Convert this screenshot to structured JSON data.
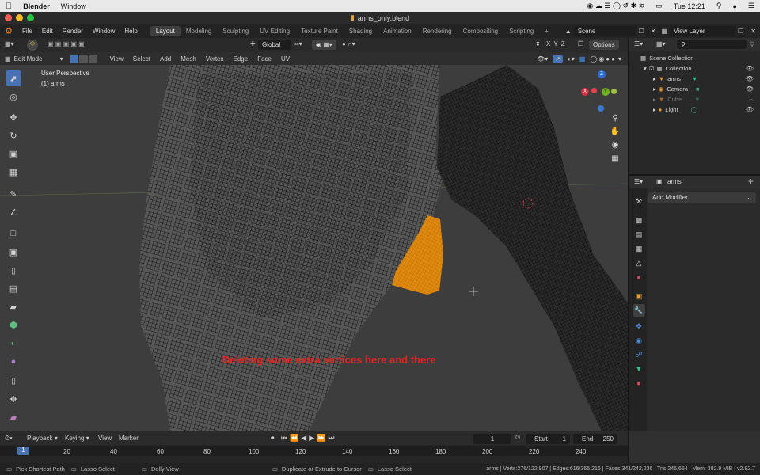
{
  "macbar": {
    "apple": "",
    "app": "Blender",
    "menu": "Window",
    "battery": "",
    "time": "Tue 12:21"
  },
  "window": {
    "title": "arms_only.blend"
  },
  "topmenu": {
    "items": [
      "File",
      "Edit",
      "Render",
      "Window",
      "Help"
    ]
  },
  "workspaces": {
    "tabs": [
      "Layout",
      "Modeling",
      "Sculpting",
      "UV Editing",
      "Texture Paint",
      "Shading",
      "Animation",
      "Rendering",
      "Compositing",
      "Scripting"
    ],
    "active": "Layout",
    "add": "+"
  },
  "scene": {
    "name": "Scene",
    "view_layer": "View Layer"
  },
  "viewport_header": {
    "mode": "Edit Mode",
    "menus": [
      "View",
      "Select",
      "Add",
      "Mesh",
      "Vertex",
      "Edge",
      "Face",
      "UV"
    ],
    "orientation": "Global",
    "options": "Options",
    "axes": [
      "X",
      "Y",
      "Z"
    ]
  },
  "viewport": {
    "perspective": "User Perspective",
    "object": "(1) arms",
    "annotation": "Deleting some extra vertices here and there"
  },
  "gizmo": {
    "x": "X",
    "y": "Y",
    "z": "Z"
  },
  "outliner": {
    "search_placeholder": "",
    "scene_collection": "Scene Collection",
    "collection": "Collection",
    "items": [
      "arms",
      "Camera",
      "Cube",
      "Light"
    ]
  },
  "properties": {
    "object": "arms",
    "add_modifier": "Add Modifier"
  },
  "timeline": {
    "menus": [
      "Playback",
      "Keying",
      "View",
      "Marker"
    ],
    "current_frame": "1",
    "start_label": "Start",
    "start": "1",
    "end_label": "End",
    "end": "250",
    "ruler": [
      "1",
      "20",
      "40",
      "60",
      "80",
      "100",
      "120",
      "140",
      "160",
      "180",
      "200",
      "220",
      "240"
    ]
  },
  "statusbar": {
    "left1": "Pick Shortest Path",
    "left2": "Lasso Select",
    "left3": "Dolly View",
    "mid1": "Duplicate or Extrude to Cursor",
    "mid2": "Lasso Select",
    "stats": "arms | Verts:276/122,907 | Edges:616/365,216 | Faces:341/242,236 | Tris:245,654 | Mem: 382.9 MiB | v2.82.7"
  }
}
